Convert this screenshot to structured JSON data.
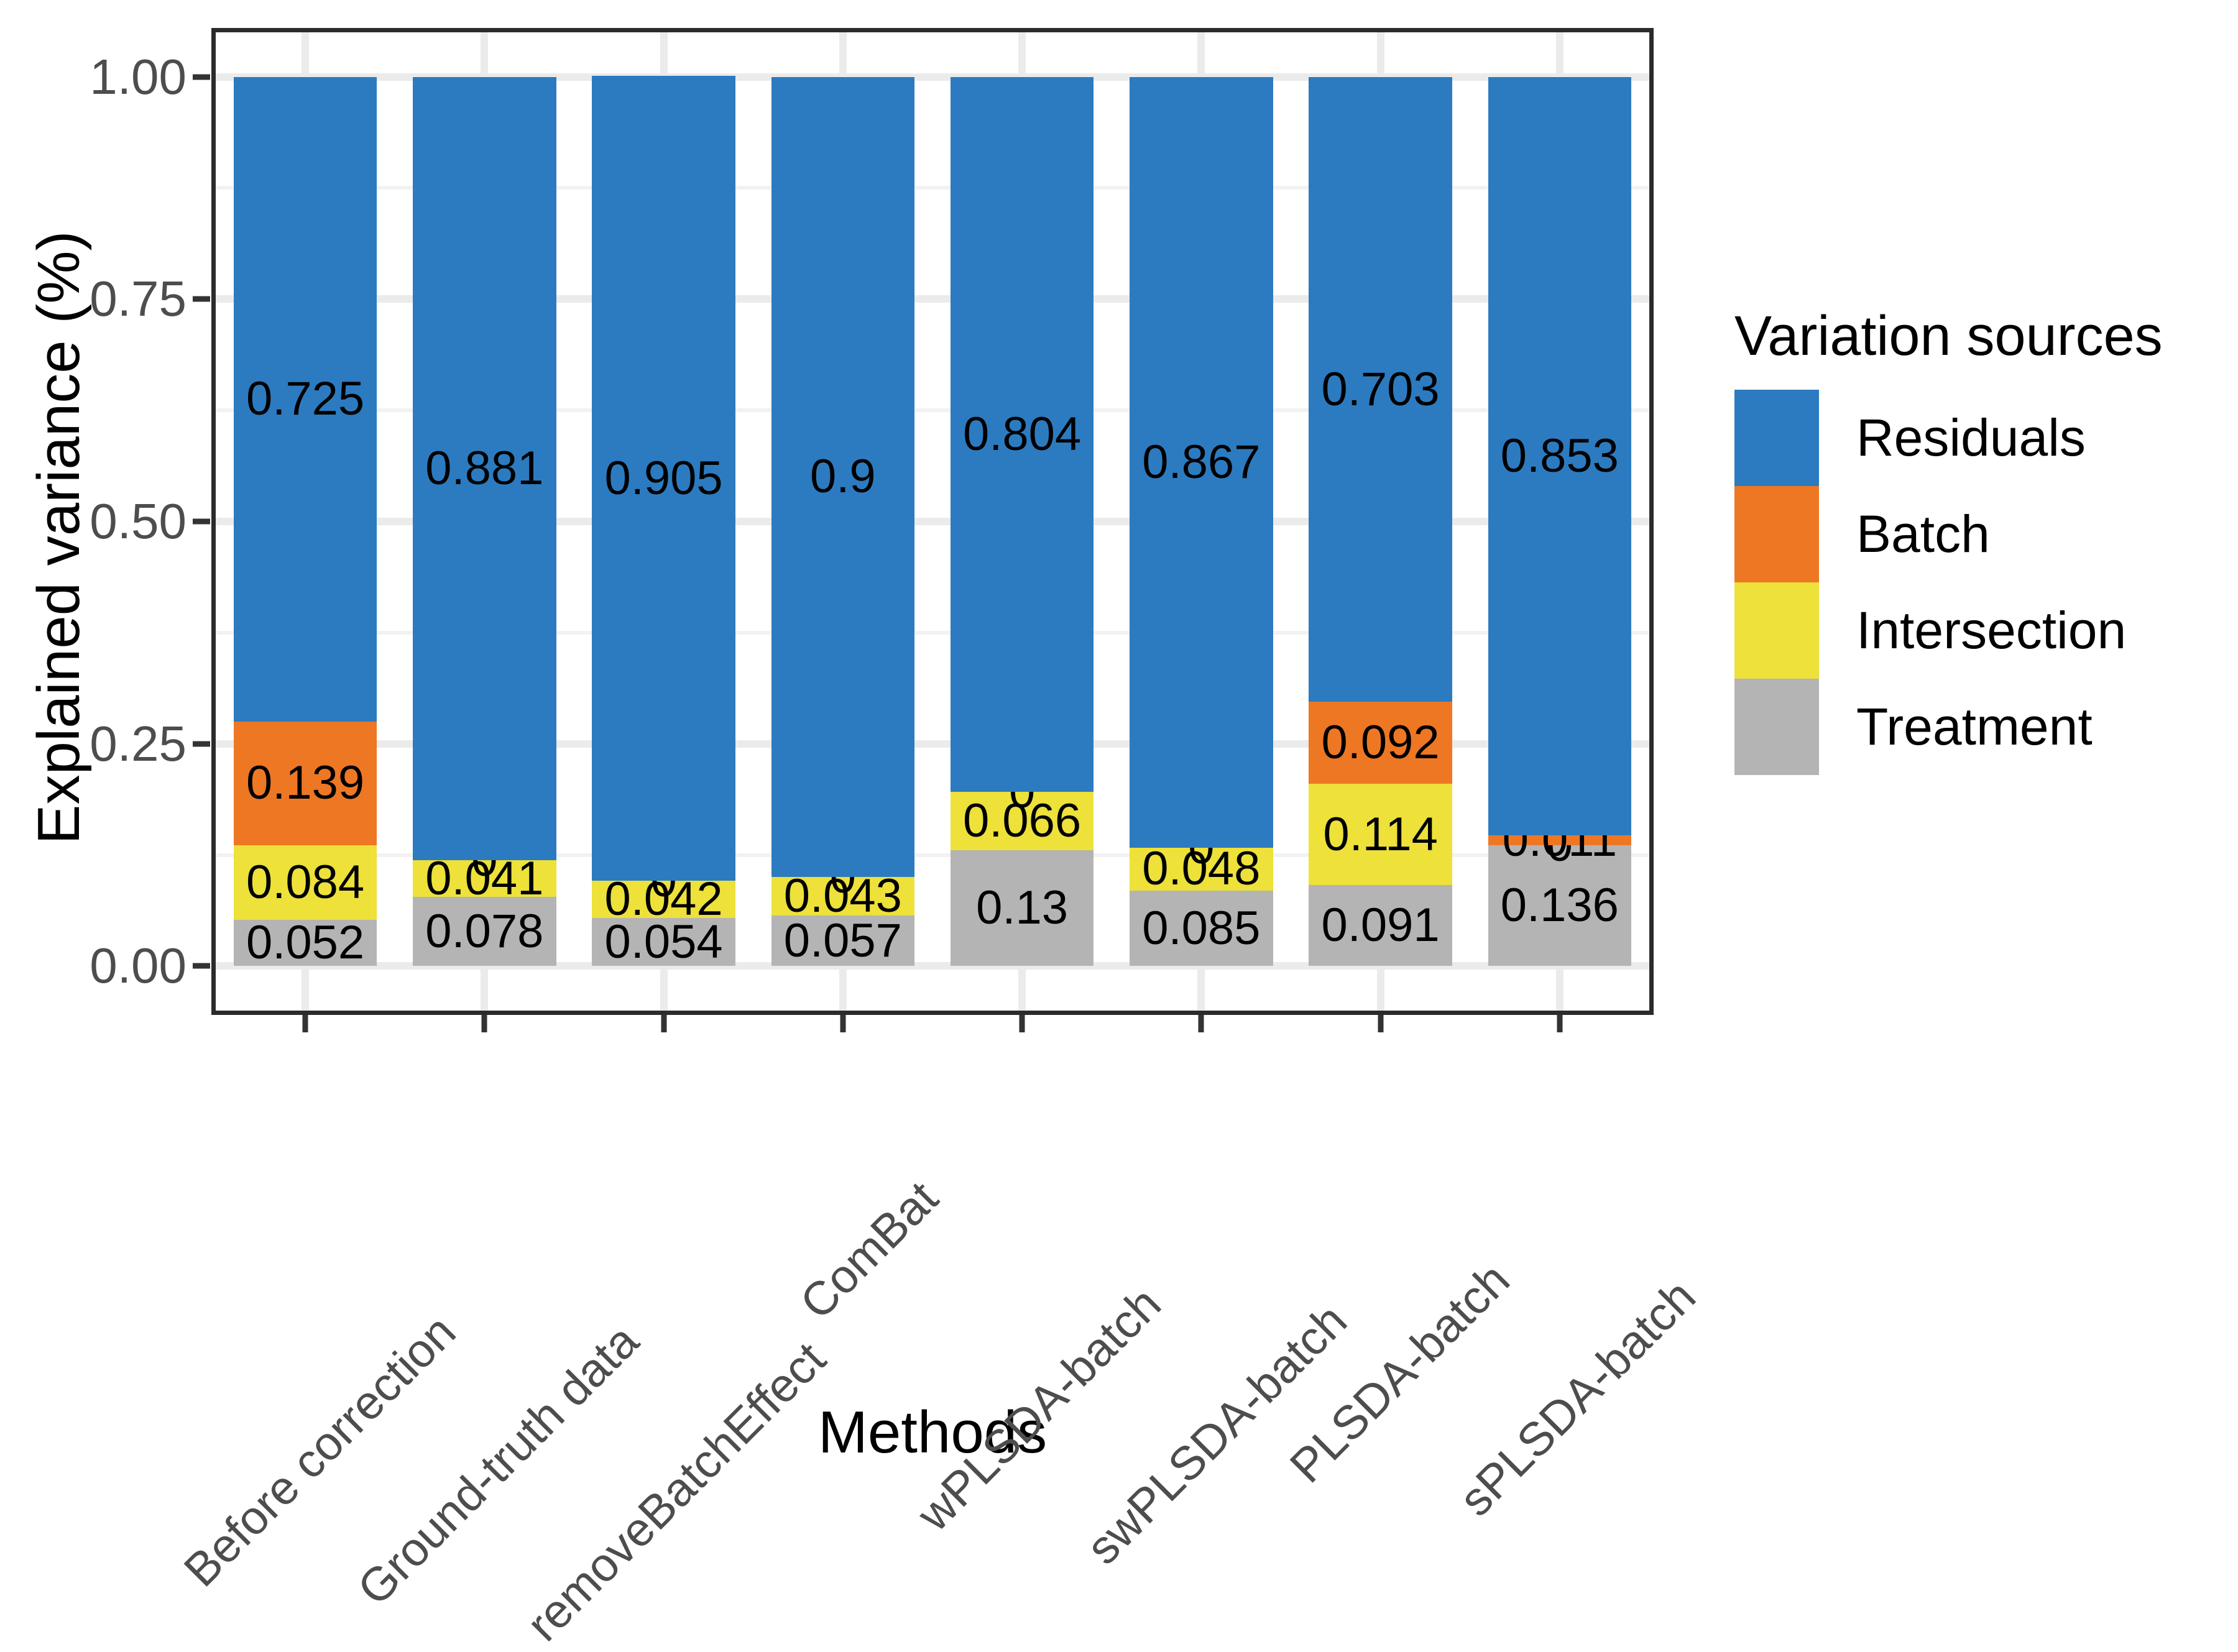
{
  "chart_data": {
    "type": "bar",
    "stacked": true,
    "title": "",
    "xlabel": "Methods",
    "ylabel": "Explained variance (%)",
    "ylim": [
      0,
      1.0
    ],
    "ytick_values": [
      0.0,
      0.25,
      0.5,
      0.75,
      1.0
    ],
    "ytick_labels": [
      "0.00",
      "0.25",
      "0.50",
      "0.75",
      "1.00"
    ],
    "grid": true,
    "grid_minor_y": [
      0.125,
      0.375,
      0.625,
      0.875
    ],
    "legend_title": "Variation sources",
    "legend_position": "right",
    "categories": [
      "Before correction",
      "Ground-truth data",
      "removeBatchEffect",
      "ComBat",
      "wPLSDA-batch",
      "swPLSDA-batch",
      "PLSDA-batch",
      "sPLSDA-batch"
    ],
    "stack_order_bottom_to_top": [
      "Treatment",
      "Intersection",
      "Batch",
      "Residuals"
    ],
    "series": [
      {
        "name": "Treatment",
        "color": "#b4b4b4",
        "values": [
          0.052,
          0.078,
          0.054,
          0.057,
          0.13,
          0.085,
          0.091,
          0.136
        ],
        "labels": [
          "0.052",
          "0.078",
          "0.054",
          "0.057",
          "0.13",
          "0.085",
          "0.091",
          "0.136"
        ]
      },
      {
        "name": "Intersection",
        "color": "#ede13a",
        "values": [
          0.084,
          0.041,
          0.042,
          0.043,
          0.066,
          0.048,
          0.114,
          0
        ],
        "labels": [
          "0.084",
          "0.041",
          "0.042",
          "0.043",
          "0.066",
          "0.048",
          "0.114",
          "0"
        ]
      },
      {
        "name": "Batch",
        "color": "#ee7724",
        "values": [
          0.139,
          0,
          0,
          0,
          0,
          0,
          0.092,
          0.011
        ],
        "labels": [
          "0.139",
          "0",
          "0",
          "0",
          "0",
          "0",
          "0.092",
          "0.011"
        ]
      },
      {
        "name": "Residuals",
        "color": "#2c7bc0",
        "values": [
          0.725,
          0.881,
          0.905,
          0.9,
          0.804,
          0.867,
          0.703,
          0.853
        ],
        "labels": [
          "0.725",
          "0.881",
          "0.905",
          "0.9",
          "0.804",
          "0.867",
          "0.703",
          "0.853"
        ]
      }
    ]
  },
  "legend": {
    "title": "Variation sources",
    "items": [
      {
        "label": "Residuals",
        "color": "#2c7bc0"
      },
      {
        "label": "Batch",
        "color": "#ee7724"
      },
      {
        "label": "Intersection",
        "color": "#ede13a"
      },
      {
        "label": "Treatment",
        "color": "#b4b4b4"
      }
    ]
  },
  "axes": {
    "x_title": "Methods",
    "y_title": "Explained variance (%)",
    "y_ticks": [
      "0.00",
      "0.25",
      "0.50",
      "0.75",
      "1.00"
    ],
    "x_ticks": [
      "Before correction",
      "Ground-truth data",
      "removeBatchEffect",
      "ComBat",
      "wPLSDA-batch",
      "swPLSDA-batch",
      "PLSDA-batch",
      "sPLSDA-batch"
    ]
  },
  "colors": {
    "residuals": "#2c7bc0",
    "batch": "#ee7724",
    "intersection": "#ede13a",
    "treatment": "#b4b4b4",
    "panel_border": "#2b2b2b",
    "grid_major": "#ebebeb",
    "grid_minor": "#f2f2f2",
    "tick_text": "#4d4d4d",
    "axis_title": "#000000"
  }
}
